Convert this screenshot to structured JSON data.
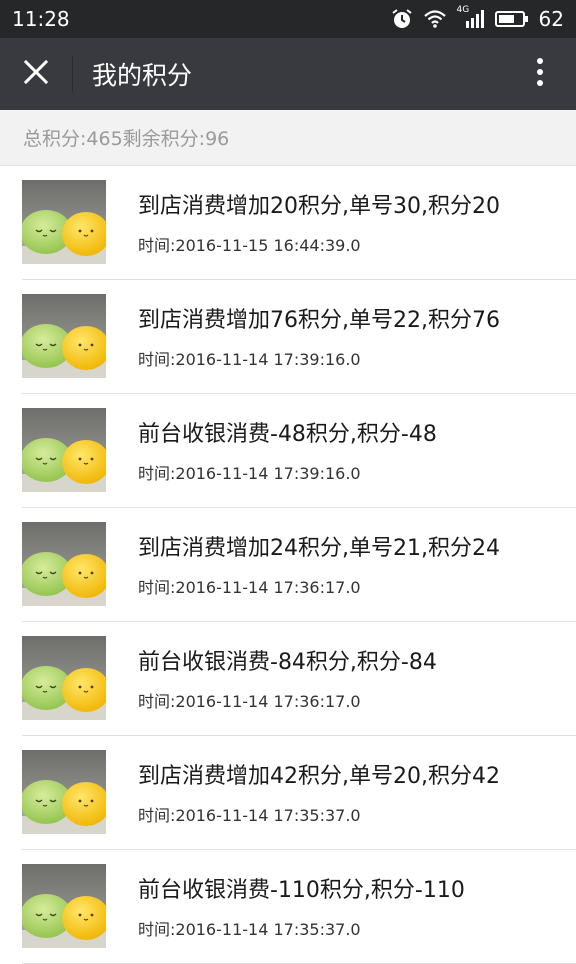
{
  "status_bar": {
    "time": "11:28",
    "network_label": "4G",
    "battery_level": "62",
    "icons": [
      "alarm-icon",
      "wifi-icon",
      "signal-icon",
      "battery-icon"
    ]
  },
  "title_bar": {
    "title": "我的积分",
    "close_icon": "close-icon",
    "more_icon": "more-vertical-icon"
  },
  "summary": {
    "text": "总积分:465剩余积分:96"
  },
  "records": [
    {
      "title": "到店消费增加20积分,单号30,积分20",
      "time": "时间:2016-11-15 16:44:39.0"
    },
    {
      "title": "到店消费增加76积分,单号22,积分76",
      "time": "时间:2016-11-14 17:39:16.0"
    },
    {
      "title": "前台收银消费-48积分,积分-48",
      "time": "时间:2016-11-14 17:39:16.0"
    },
    {
      "title": "到店消费增加24积分,单号21,积分24",
      "time": "时间:2016-11-14 17:36:17.0"
    },
    {
      "title": "前台收银消费-84积分,积分-84",
      "time": "时间:2016-11-14 17:36:17.0"
    },
    {
      "title": "到店消费增加42积分,单号20,积分42",
      "time": "时间:2016-11-14 17:35:37.0"
    },
    {
      "title": "前台收银消费-110积分,积分-110",
      "time": "时间:2016-11-14 17:35:37.0"
    }
  ],
  "colors": {
    "status_bar_bg": "#262729",
    "title_bar_bg": "#393a3f",
    "summary_bg": "#f2f2f2"
  }
}
